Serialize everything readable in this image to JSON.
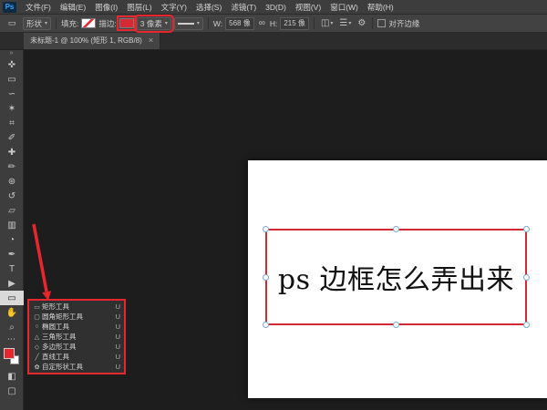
{
  "colors": {
    "annotation_red": "#e8262d",
    "shape_stroke_red": "#d42a36",
    "foreground_red": "#e8262d"
  },
  "app": {
    "logo": "Ps",
    "menus": [
      "文件(F)",
      "编辑(E)",
      "图像(I)",
      "图层(L)",
      "文字(Y)",
      "选择(S)",
      "滤镜(T)",
      "3D(D)",
      "视图(V)",
      "窗口(W)",
      "帮助(H)"
    ]
  },
  "options_bar": {
    "tool_preset_icon": "▭",
    "mode": "形状",
    "fill_label": "填充:",
    "stroke_label": "描边:",
    "stroke_width": "3 像素",
    "w_label": "W:",
    "w_value": "568 像",
    "link_icon": "∞",
    "h_label": "H:",
    "h_value": "215 像",
    "path_ops_icon": "◫",
    "align_icon": "☰",
    "gear_icon": "⚙",
    "align_edges_label": "对齐边缘",
    "caret": "▾"
  },
  "tab_bar": {
    "tab_title": "未标题-1 @ 100% (矩形 1, RGB/8)",
    "close_glyph": "×"
  },
  "toolbar": {
    "collapse_glyph": "»",
    "more_glyph": "⋯",
    "quick_mask_glyph": "◧",
    "screen_mode_glyph": "▢",
    "tools": [
      {
        "name": "move-tool",
        "glyph": "✜"
      },
      {
        "name": "marquee-tool",
        "glyph": "▭"
      },
      {
        "name": "lasso-tool",
        "glyph": "∽"
      },
      {
        "name": "magic-wand-tool",
        "glyph": "✶"
      },
      {
        "name": "crop-tool",
        "glyph": "⌗"
      },
      {
        "name": "eyedropper-tool",
        "glyph": "✐"
      },
      {
        "name": "healing-brush-tool",
        "glyph": "✚"
      },
      {
        "name": "brush-tool",
        "glyph": "✏"
      },
      {
        "name": "clone-stamp-tool",
        "glyph": "⊛"
      },
      {
        "name": "history-brush-tool",
        "glyph": "↺"
      },
      {
        "name": "eraser-tool",
        "glyph": "▱"
      },
      {
        "name": "gradient-tool",
        "glyph": "▥"
      },
      {
        "name": "blur-tool",
        "glyph": "◔"
      },
      {
        "name": "pen-tool",
        "glyph": "✒"
      },
      {
        "name": "type-tool",
        "glyph": "T"
      },
      {
        "name": "path-selection-tool",
        "glyph": "▶"
      },
      {
        "name": "rectangle-tool",
        "glyph": "▭"
      },
      {
        "name": "hand-tool",
        "glyph": "✋"
      },
      {
        "name": "zoom-tool",
        "glyph": "⌕"
      }
    ]
  },
  "shape_flyout": {
    "items": [
      {
        "icon": "▭",
        "label": "矩形工具",
        "shortcut": "U"
      },
      {
        "icon": "▢",
        "label": "圆角矩形工具",
        "shortcut": "U"
      },
      {
        "icon": "○",
        "label": "椭圆工具",
        "shortcut": "U"
      },
      {
        "icon": "△",
        "label": "三角形工具",
        "shortcut": "U"
      },
      {
        "icon": "◇",
        "label": "多边形工具",
        "shortcut": "U"
      },
      {
        "icon": "╱",
        "label": "直线工具",
        "shortcut": "U"
      },
      {
        "icon": "✿",
        "label": "自定形状工具",
        "shortcut": "U"
      }
    ]
  },
  "canvas": {
    "shape_text": "ps 边框怎么弄出来"
  }
}
